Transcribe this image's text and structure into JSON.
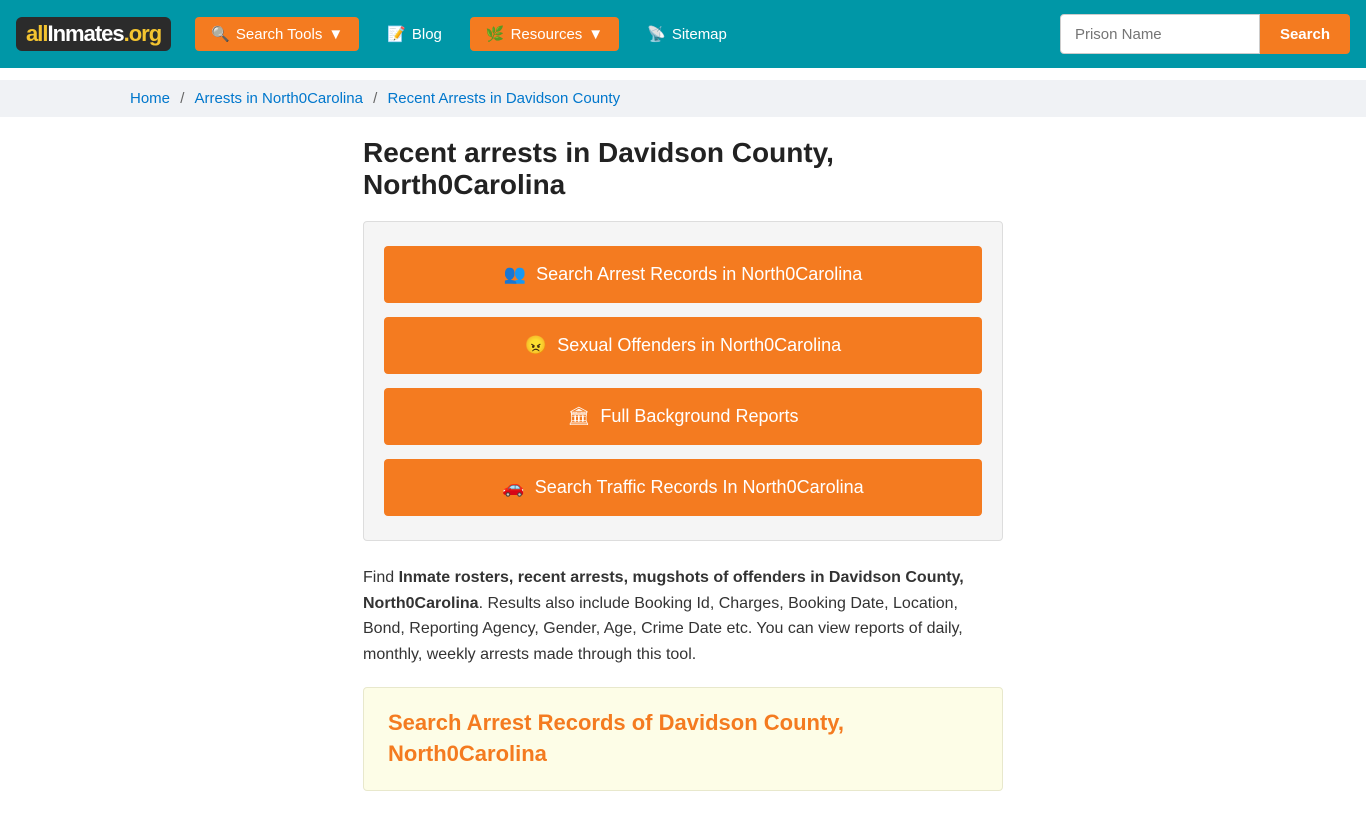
{
  "navbar": {
    "logo": "allinmates.org",
    "logo_parts": {
      "all": "all",
      "inmates": "Inmates",
      "org": ".org"
    },
    "search_tools_label": "Search Tools",
    "blog_label": "Blog",
    "resources_label": "Resources",
    "sitemap_label": "Sitemap",
    "prison_name_placeholder": "Prison Name",
    "search_button_label": "Search"
  },
  "breadcrumb": {
    "home": "Home",
    "state": "Arrests in North0Carolina",
    "current": "Recent Arrests in Davidson County"
  },
  "main": {
    "page_title": "Recent arrests in Davidson County, North0Carolina",
    "buttons": [
      {
        "id": "btn-arrest",
        "label": "Search Arrest Records in North0Carolina",
        "icon": "👥"
      },
      {
        "id": "btn-offenders",
        "label": "Sexual Offenders in North0Carolina",
        "icon": "😠"
      },
      {
        "id": "btn-background",
        "label": "Full Background Reports",
        "icon": "🏛"
      },
      {
        "id": "btn-traffic",
        "label": "Search Traffic Records In North0Carolina",
        "icon": "🚗"
      }
    ],
    "description_prefix": "Find ",
    "description_bold": "Inmate rosters, recent arrests, mugshots of offenders in Davidson County, North0Carolina",
    "description_suffix": ". Results also include Booking Id, Charges, Booking Date, Location, Bond, Reporting Agency, Gender, Age, Crime Date etc. You can view reports of daily, monthly, weekly arrests made through this tool.",
    "bottom_title_line1": "Search Arrest Records of Davidson County,",
    "bottom_title_line2": "North0Carolina"
  }
}
